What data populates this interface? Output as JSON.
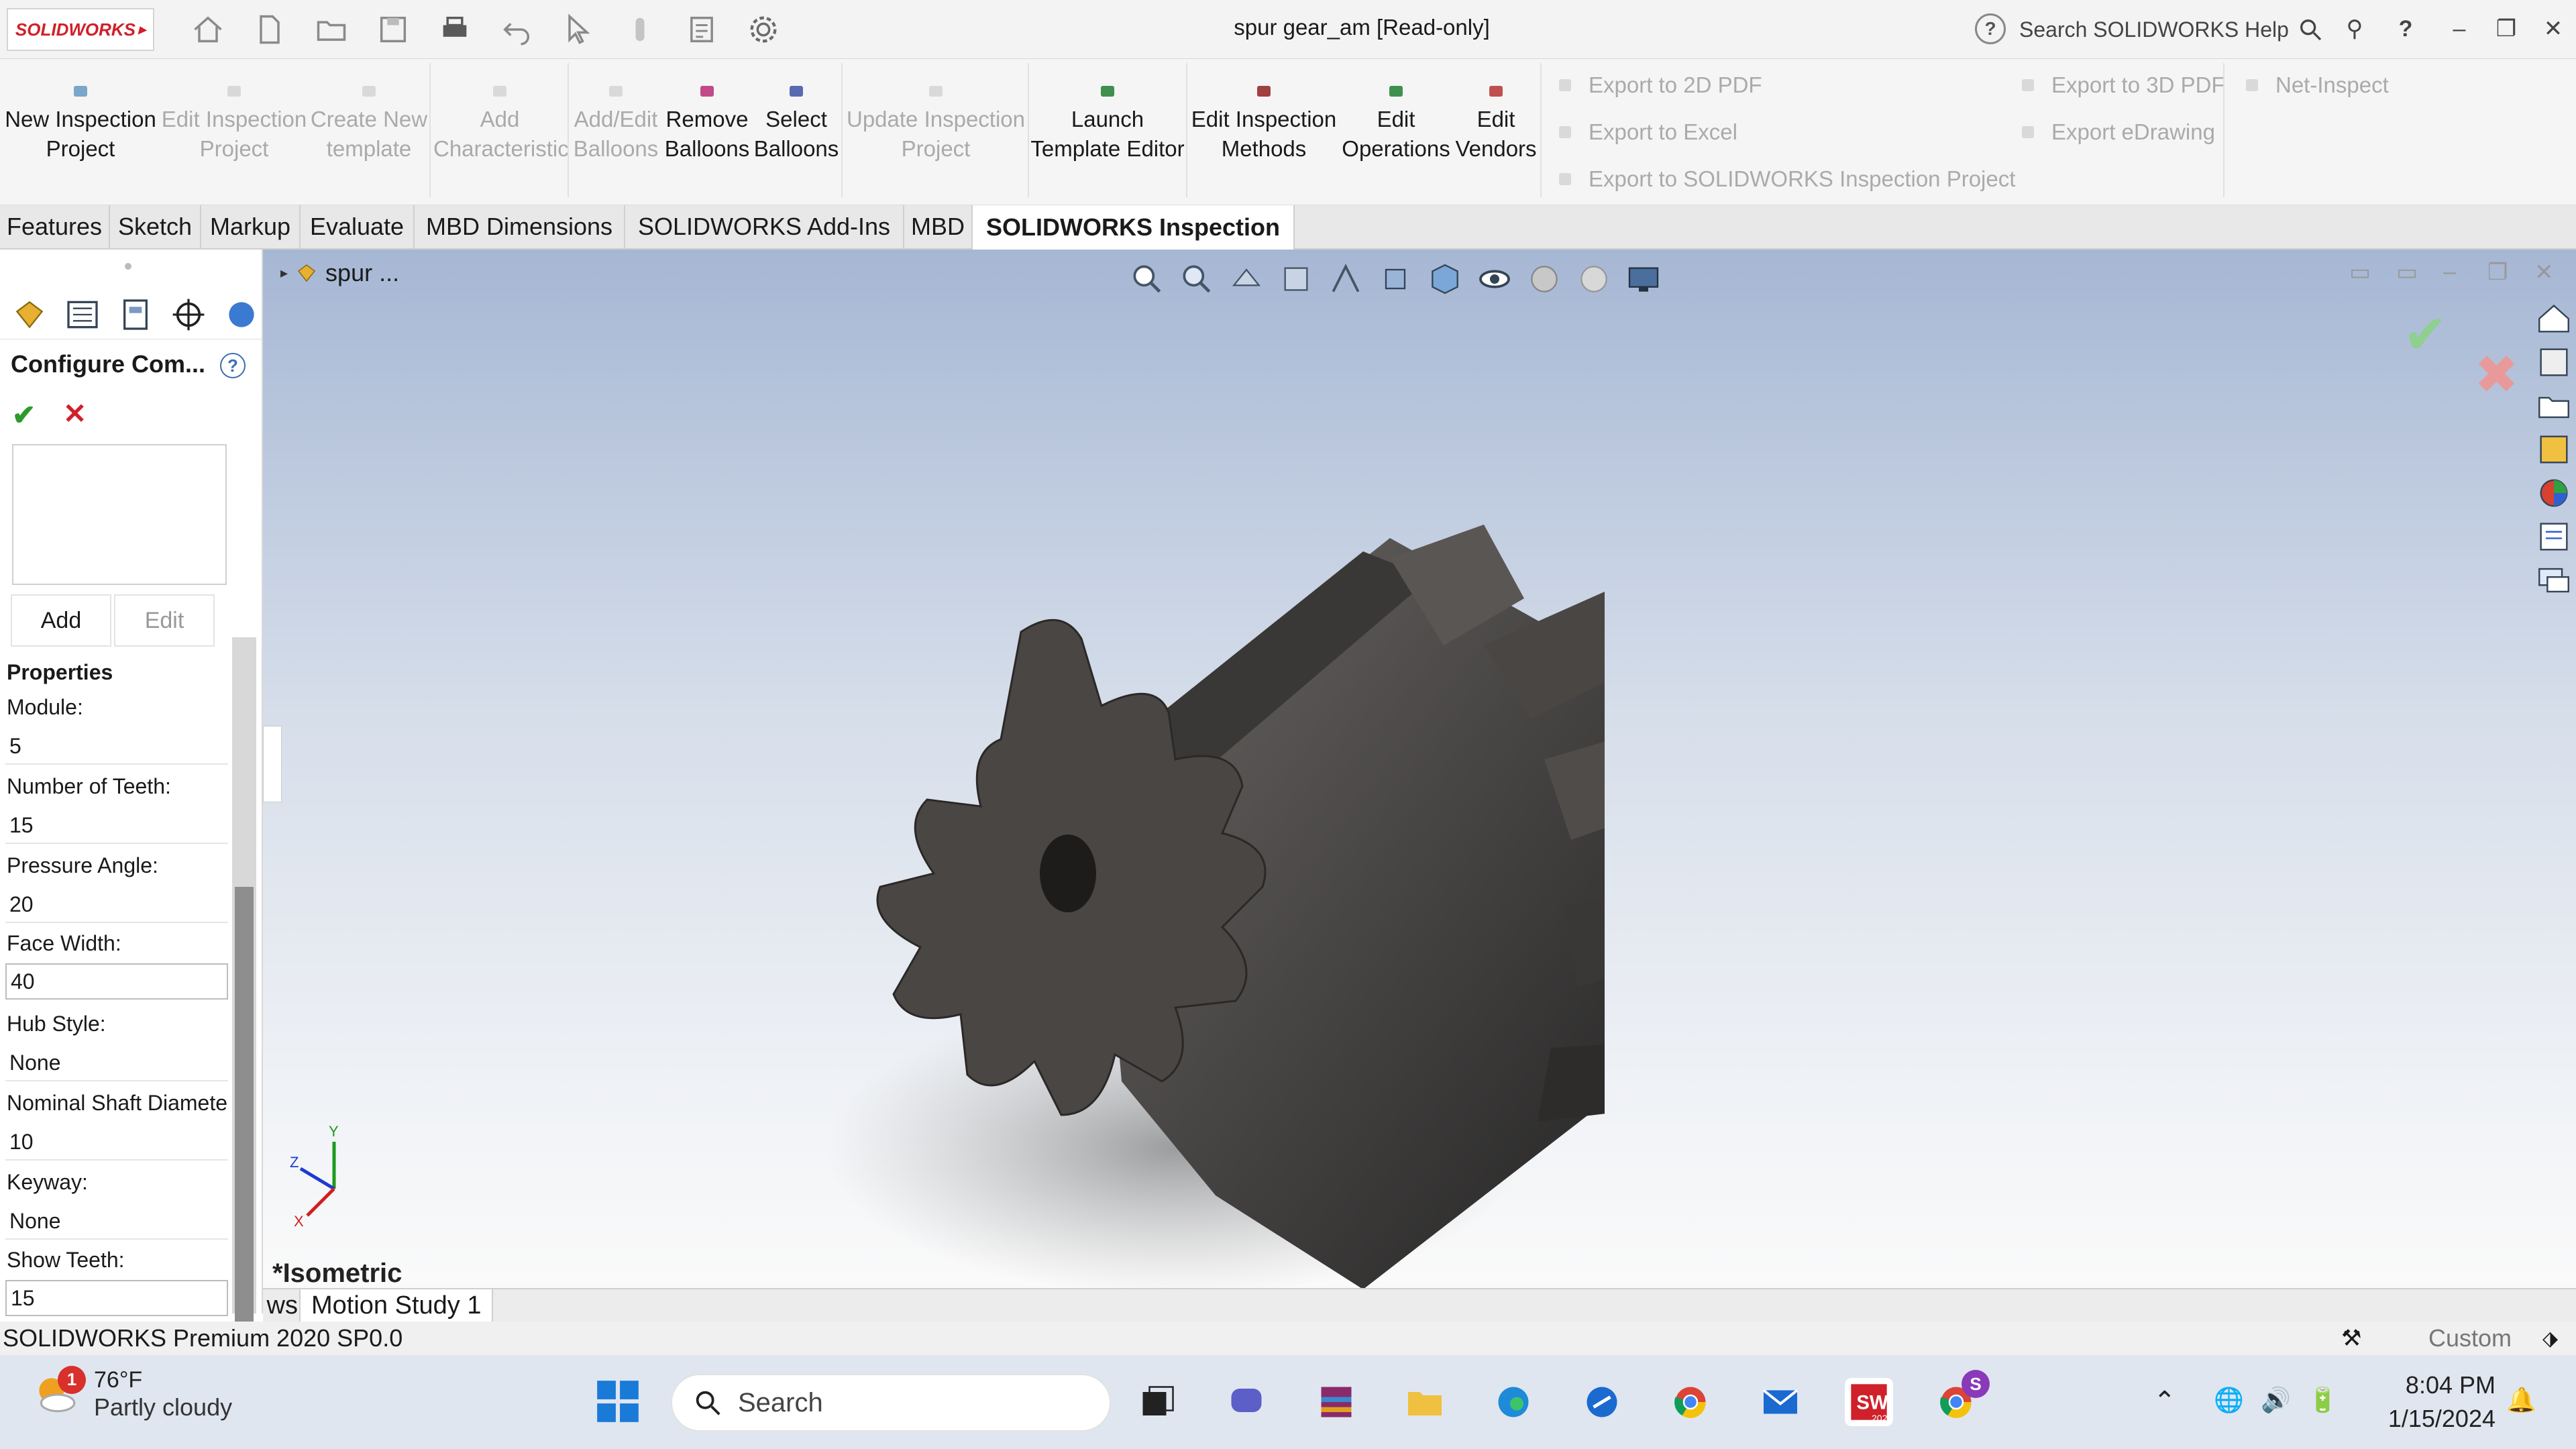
{
  "app": {
    "brand": "SOLIDWORKS",
    "window_title": "spur gear_am [Read-only]",
    "search_placeholder": "Search SOLIDWORKS Help",
    "help_icon": "?"
  },
  "ribbon": {
    "buttons": [
      {
        "label1": "New Inspection",
        "label2": "Project",
        "enabled": true
      },
      {
        "label1": "Edit Inspection",
        "label2": "Project",
        "enabled": false
      },
      {
        "label1": "Create New",
        "label2": "template",
        "enabled": false
      },
      {
        "label1": "Add",
        "label2": "Characteristic",
        "enabled": false
      },
      {
        "label1": "Add/Edit",
        "label2": "Balloons",
        "enabled": false
      },
      {
        "label1": "Remove",
        "label2": "Balloons",
        "enabled": true
      },
      {
        "label1": "Select",
        "label2": "Balloons",
        "enabled": true
      },
      {
        "label1": "Update Inspection",
        "label2": "Project",
        "enabled": false
      },
      {
        "label1": "Launch",
        "label2": "Template Editor",
        "enabled": true
      },
      {
        "label1": "Edit Inspection",
        "label2": "Methods",
        "enabled": true
      },
      {
        "label1": "Edit",
        "label2": "Operations",
        "enabled": true
      },
      {
        "label1": "Edit",
        "label2": "Vendors",
        "enabled": true
      }
    ],
    "exports": {
      "pdf2d": "Export to 2D PDF",
      "excel": "Export to Excel",
      "sw_project": "Export to SOLIDWORKS Inspection Project",
      "pdf3d": "Export to 3D PDF",
      "edrawing": "Export eDrawing",
      "net_inspect": "Net-Inspect"
    }
  },
  "tabs": [
    "Features",
    "Sketch",
    "Markup",
    "Evaluate",
    "MBD Dimensions",
    "SOLIDWORKS Add-Ins",
    "MBD",
    "SOLIDWORKS Inspection"
  ],
  "active_tab": "SOLIDWORKS Inspection",
  "panel": {
    "title": "Configure Com...",
    "add_label": "Add",
    "edit_label": "Edit",
    "properties_header": "Properties",
    "fields": [
      {
        "label": "Module:",
        "value": "5"
      },
      {
        "label": "Number of Teeth:",
        "value": "15"
      },
      {
        "label": "Pressure Angle:",
        "value": "20"
      },
      {
        "label": "Face Width:",
        "value": "40"
      },
      {
        "label": "Hub Style:",
        "value": "None"
      },
      {
        "label": "Nominal Shaft Diamete",
        "value": "10"
      },
      {
        "label": "Keyway:",
        "value": "None"
      },
      {
        "label": "Show Teeth:",
        "value": "15"
      }
    ]
  },
  "viewport": {
    "tree_label": "spur ...",
    "view_name": "*Isometric",
    "triad": {
      "x": "X",
      "y": "Y",
      "z": "Z"
    }
  },
  "bottom_tabs": {
    "partial": "ws",
    "motion": "Motion Study 1"
  },
  "status": {
    "left": "SOLIDWORKS Premium 2020 SP0.0",
    "right": "Custom"
  },
  "taskbar": {
    "temperature": "76°F",
    "condition": "Partly cloudy",
    "weather_badge": "1",
    "search_label": "Search",
    "time": "8:04 PM",
    "date": "1/15/2024",
    "sw_badge": "2020",
    "chrome_profile": "S"
  },
  "colors": {
    "brand_red": "#d0202a",
    "ok_green": "#2c9a2c",
    "gear_face": "#4a4644",
    "taskbar_bg": "#dfe6f0"
  }
}
